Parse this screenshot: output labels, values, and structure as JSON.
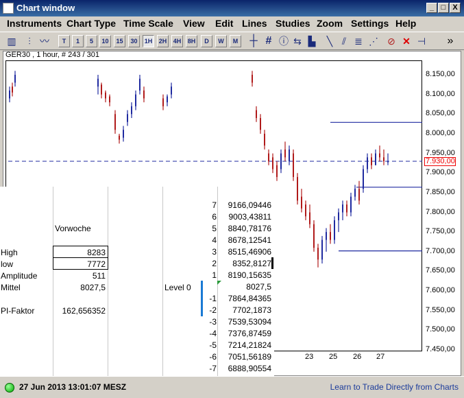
{
  "window": {
    "title": "Chart window",
    "min_label": "_",
    "max_label": "□",
    "close_label": "X"
  },
  "menu": [
    "Instruments",
    "Chart Type",
    "Time Scale",
    "View",
    "Edit",
    "Lines",
    "Studies",
    "Zoom",
    "Settings",
    "Help"
  ],
  "toolbar": {
    "timescale_buttons": [
      "T",
      "1",
      "5",
      "10",
      "15",
      "30",
      "1H",
      "2H",
      "4H",
      "8H",
      "D",
      "W",
      "M"
    ],
    "active_timescale": "1H",
    "more_label": "»"
  },
  "chart": {
    "info": "GER30 , 1 hour, # 243 / 301",
    "y_ticks": [
      "8.150,00",
      "8.100,00",
      "8.050,00",
      "8.000,00",
      "7.950,00",
      "7.900,00",
      "7.850,00",
      "7.800,00",
      "7.750,00",
      "7.700,00",
      "7.650,00",
      "7.600,00",
      "7.550,00",
      "7.500,00",
      "7.450,00"
    ],
    "x_ticks": [
      "23",
      "25",
      "26",
      "27"
    ],
    "current_price": "7.930,00",
    "colors": {
      "up": "#1f2aa0",
      "down": "#b01a1a",
      "line": "#1f2aa0",
      "tag": "#e00000"
    }
  },
  "sheet": {
    "header": "Vorwoche",
    "stats": [
      {
        "label": "High",
        "value": "8283"
      },
      {
        "label": "low",
        "value": "7772"
      },
      {
        "label": "Amplitude",
        "value": "511"
      },
      {
        "label": "Mittel",
        "value": "8027,5"
      }
    ],
    "pi_label": "PI-Faktor",
    "pi_value": "162,656352",
    "level0_label": "Level 0",
    "levels": [
      {
        "n": "7",
        "v": "9166,09446"
      },
      {
        "n": "6",
        "v": "9003,43811"
      },
      {
        "n": "5",
        "v": "8840,78176"
      },
      {
        "n": "4",
        "v": "8678,12541"
      },
      {
        "n": "3",
        "v": "8515,46906"
      },
      {
        "n": "2",
        "v": "8352,8127"
      },
      {
        "n": "1",
        "v": "8190,15635"
      },
      {
        "n": "",
        "v": "8027,5"
      },
      {
        "n": "-1",
        "v": "7864,84365"
      },
      {
        "n": "-2",
        "v": "7702,1873"
      },
      {
        "n": "-3",
        "v": "7539,53094"
      },
      {
        "n": "-4",
        "v": "7376,87459"
      },
      {
        "n": "-5",
        "v": "7214,21824"
      },
      {
        "n": "-6",
        "v": "7051,56189"
      },
      {
        "n": "-7",
        "v": "6888,90554"
      }
    ]
  },
  "status": {
    "datetime": "27 Jun 2013 13:01:07 MESZ",
    "link": "Learn to Trade Directly from Charts"
  }
}
